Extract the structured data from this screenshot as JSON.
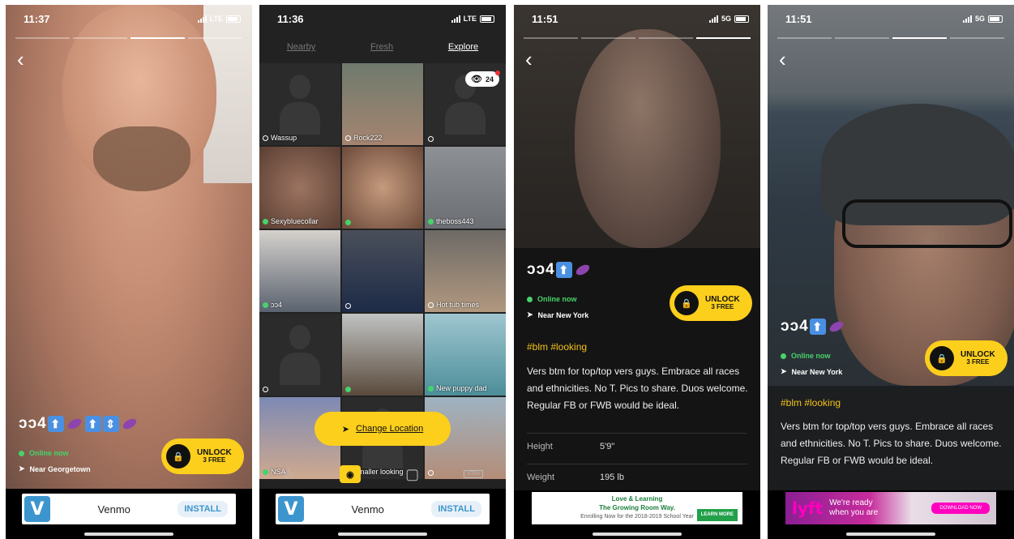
{
  "panels": {
    "p1": {
      "time": "11:37",
      "carrier": "LTE",
      "emoji_text": "ɔɔ4",
      "online": "Online now",
      "location": "Near Georgetown",
      "unlock": "UNLOCK",
      "unlock_sub": "3 FREE",
      "ad": {
        "name": "Venmo",
        "install": "INSTALL",
        "logo": "V"
      }
    },
    "p2": {
      "time": "11:36",
      "carrier": "LTE",
      "tabs": [
        "Nearby",
        "Fresh",
        "Explore"
      ],
      "viewers": "24",
      "cells": [
        {
          "name": "Wassup",
          "status": "ring"
        },
        {
          "name": "Rock222",
          "status": "ring"
        },
        {
          "name": "",
          "status": "ring"
        },
        {
          "name": "Sexybluecollar",
          "status": "online"
        },
        {
          "name": "",
          "status": "online"
        },
        {
          "name": "theboss443",
          "status": "online"
        },
        {
          "name": "ɔɔ4",
          "status": "online"
        },
        {
          "name": "",
          "status": "ring"
        },
        {
          "name": "Hot tub times",
          "status": "ring"
        },
        {
          "name": "",
          "status": "ring"
        },
        {
          "name": "",
          "status": "online"
        },
        {
          "name": "New puppy dad",
          "status": "online"
        },
        {
          "name": "NSA",
          "status": "online"
        },
        {
          "name": "Smaller looking",
          "status": "ring"
        },
        {
          "name": "",
          "status": "ring"
        }
      ],
      "change_location": "Change Location",
      "nav_xtra": "XTRA",
      "ad": {
        "name": "Venmo",
        "install": "INSTALL",
        "logo": "V"
      }
    },
    "p3": {
      "time": "11:51",
      "carrier": "5G",
      "emoji_text": "ɔɔ4",
      "online": "Online now",
      "location": "Near New York",
      "unlock": "UNLOCK",
      "unlock_sub": "3 FREE",
      "tags": "#blm #looking",
      "bio": "Vers btm for top/top vers guys. Embrace all races and ethnicities. No T. Pics to share. Duos welcome. Regular FB or FWB would be ideal.",
      "stats": [
        {
          "key": "Height",
          "value": "5'9\""
        },
        {
          "key": "Weight",
          "value": "195 lb"
        }
      ],
      "ad": {
        "line1": "Love & Learning",
        "line2": "The Growing Room Way.",
        "line3": "Enrolling Now for the 2018-2019 School Year",
        "brand": "Growing Room",
        "button": "LEARN MORE"
      }
    },
    "p4": {
      "time": "11:51",
      "carrier": "5G",
      "emoji_text": "ɔɔ4",
      "online": "Online now",
      "location": "Near New York",
      "unlock": "UNLOCK",
      "unlock_sub": "3 FREE",
      "tags": "#blm #looking",
      "bio": "Vers btm for top/top vers guys. Embrace all races and ethnicities. No T. Pics to share. Duos welcome. Regular FB or FWB would be ideal.",
      "ad": {
        "logo": "lyft",
        "line1": "We're ready",
        "line2": "when you are",
        "button": "DOWNLOAD NOW"
      }
    }
  },
  "colors": {
    "accent_yellow": "#fccf1c",
    "online_green": "#46d36b",
    "venmo_blue": "#3d95ce"
  }
}
